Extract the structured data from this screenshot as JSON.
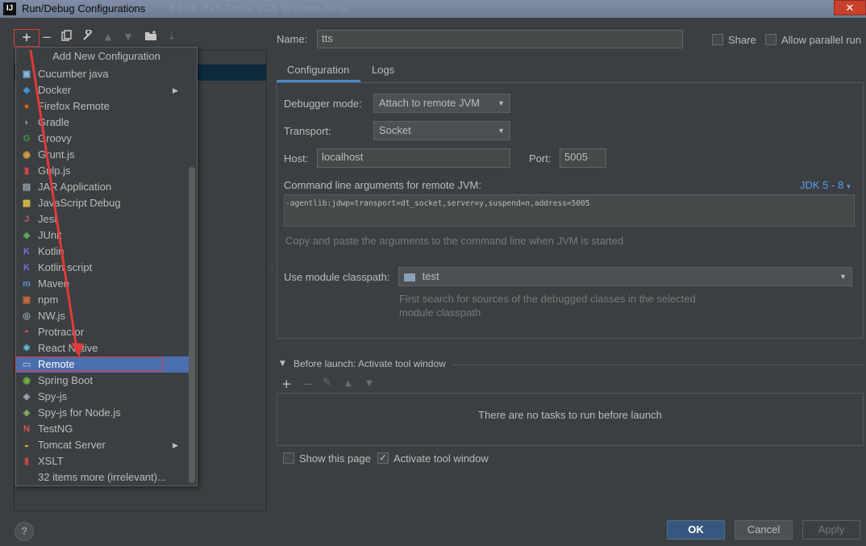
{
  "window": {
    "title": "Run/Debug Configurations",
    "app_icon": "IJ",
    "close_glyph": "✕",
    "background_menu_ghost": "ESXX Refl Tools VCS Window Help"
  },
  "toolbar": {
    "add": "+",
    "remove": "−",
    "copy_icon": "copy-icon",
    "edit_icon": "wrench-icon",
    "move_up_icon": "arrow-up-icon",
    "move_down_icon": "arrow-down-icon",
    "folder_icon": "new-folder-icon",
    "sort_icon": "sort-icon"
  },
  "popup": {
    "header": "Add New Configuration",
    "items": [
      {
        "label": "Cucumber java",
        "icon": "cucumber-icon",
        "color": "#7fb8e6",
        "glyph": "▣"
      },
      {
        "label": "Docker",
        "icon": "docker-icon",
        "color": "#3f8fd6",
        "glyph": "◆",
        "submenu": true
      },
      {
        "label": "Firefox Remote",
        "icon": "firefox-icon",
        "color": "#e66000",
        "glyph": "●"
      },
      {
        "label": "Gradle",
        "icon": "gradle-icon",
        "color": "#8fa38f",
        "glyph": "◗"
      },
      {
        "label": "Groovy",
        "icon": "groovy-icon",
        "color": "#3e9a3e",
        "glyph": "G"
      },
      {
        "label": "Grunt.js",
        "icon": "grunt-icon",
        "color": "#d9a13a",
        "glyph": "◉"
      },
      {
        "label": "Gulp.js",
        "icon": "gulp-icon",
        "color": "#d34545",
        "glyph": "▮"
      },
      {
        "label": "JAR Application",
        "icon": "jar-icon",
        "color": "#9aa5b1",
        "glyph": "▤"
      },
      {
        "label": "JavaScript Debug",
        "icon": "js-debug-icon",
        "color": "#d7b84a",
        "glyph": "▦"
      },
      {
        "label": "Jest",
        "icon": "jest-icon",
        "color": "#b55b6b",
        "glyph": "J"
      },
      {
        "label": "JUnit",
        "icon": "junit-icon",
        "color": "#5aa55a",
        "glyph": "◆"
      },
      {
        "label": "Kotlin",
        "icon": "kotlin-icon",
        "color": "#7d6ae6",
        "glyph": "K"
      },
      {
        "label": "Kotlin script",
        "icon": "kotlin-script-icon",
        "color": "#7d6ae6",
        "glyph": "K"
      },
      {
        "label": "Maven",
        "icon": "maven-icon",
        "color": "#5b8fd6",
        "glyph": "m"
      },
      {
        "label": "npm",
        "icon": "npm-icon",
        "color": "#cb6b3a",
        "glyph": "▣"
      },
      {
        "label": "NW.js",
        "icon": "nwjs-icon",
        "color": "#8fa0b3",
        "glyph": "◎"
      },
      {
        "label": "Protractor",
        "icon": "protractor-icon",
        "color": "#d9534f",
        "glyph": "◓"
      },
      {
        "label": "React Native",
        "icon": "react-icon",
        "color": "#61dafb",
        "glyph": "⚛"
      },
      {
        "label": "Remote",
        "icon": "remote-icon",
        "color": "#9ab3d5",
        "glyph": "▭",
        "selected": true
      },
      {
        "label": "Spring Boot",
        "icon": "spring-boot-icon",
        "color": "#6db33f",
        "glyph": "◉"
      },
      {
        "label": "Spy-js",
        "icon": "spy-js-icon",
        "color": "#9aa5b1",
        "glyph": "◈"
      },
      {
        "label": "Spy-js for Node.js",
        "icon": "spy-js-node-icon",
        "color": "#7fae5a",
        "glyph": "◈"
      },
      {
        "label": "TestNG",
        "icon": "testng-icon",
        "color": "#d9534f",
        "glyph": "N"
      },
      {
        "label": "Tomcat Server",
        "icon": "tomcat-icon",
        "color": "#e0a53a",
        "glyph": "◒",
        "submenu": true
      },
      {
        "label": "XSLT",
        "icon": "xslt-icon",
        "color": "#c24545",
        "glyph": "▮"
      },
      {
        "label": "32 items more (irrelevant)...",
        "icon": "",
        "color": "#bbbbbb",
        "glyph": ""
      }
    ]
  },
  "form": {
    "name_label": "Name:",
    "name_value": "tts",
    "share_label": "Share",
    "allow_parallel_label": "Allow parallel run",
    "tabs": [
      "Configuration",
      "Logs"
    ],
    "debugger_mode_label": "Debugger mode:",
    "debugger_mode_value": "Attach to remote JVM",
    "transport_label": "Transport:",
    "transport_value": "Socket",
    "host_label": "Host:",
    "host_value": "localhost",
    "port_label": "Port:",
    "port_value": "5005",
    "cmd_args_label": "Command line arguments for remote JVM:",
    "jdk_link": "JDK 5 - 8",
    "cmd_args_value": "-agentlib:jdwp=transport=dt_socket,server=y,suspend=n,address=5005",
    "cmd_hint": "Copy and paste the arguments to the command line when JVM is started",
    "module_label": "Use module classpath:",
    "module_value": "test",
    "module_hint_1": "First search for sources of the debugged classes in the selected",
    "module_hint_2": "module classpath"
  },
  "before_launch": {
    "title": "Before launch: Activate tool window",
    "empty_text": "There are no tasks to run before launch",
    "show_page_label": "Show this page",
    "activate_label": "Activate tool window"
  },
  "buttons": {
    "help": "?",
    "ok": "OK",
    "cancel": "Cancel",
    "apply": "Apply"
  }
}
